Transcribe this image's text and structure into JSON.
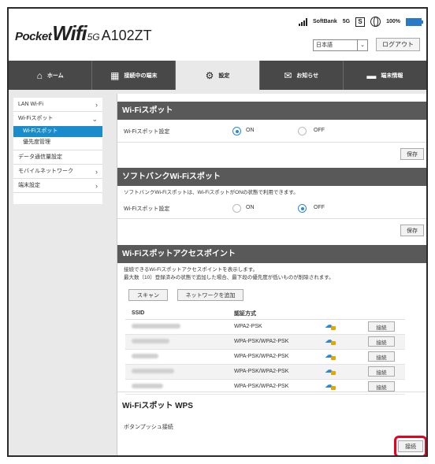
{
  "header": {
    "logo_pocket": "Pocket",
    "logo_wifi": "Wifi",
    "logo_5g": "5G",
    "model": "A102ZT",
    "carrier": "SoftBank",
    "network": "5G",
    "sim": "S",
    "battery": "100%",
    "language": "日本語",
    "logout_label": "ログアウト"
  },
  "nav": {
    "tabs": [
      {
        "label": "ホーム",
        "icon": "home-icon"
      },
      {
        "label": "接続中の端末",
        "icon": "devices-icon"
      },
      {
        "label": "設定",
        "icon": "gear-icon"
      },
      {
        "label": "お知らせ",
        "icon": "mail-icon"
      },
      {
        "label": "端末情報",
        "icon": "device-info-icon"
      }
    ],
    "active_tab": "設定"
  },
  "sidebar": {
    "items": [
      {
        "label": "LAN Wi-Fi"
      },
      {
        "label": "Wi-Fiスポット"
      },
      {
        "label": "データ通信量設定"
      },
      {
        "label": "モバイルネットワーク"
      },
      {
        "label": "端末設定"
      }
    ],
    "subitems": [
      {
        "label": "Wi-Fiスポット",
        "active": true
      },
      {
        "label": "優先度管理",
        "active": false
      }
    ]
  },
  "wifi_spot": {
    "title": "Wi-Fiスポット",
    "setting_label": "Wi-Fiスポット設定",
    "on_label": "ON",
    "off_label": "OFF",
    "selected": "ON",
    "save_label": "保存"
  },
  "softbank_spot": {
    "title": "ソフトバンクWi-Fiスポット",
    "description": "ソフトバンクWi-Fiスポットは、Wi-FiスポットがONの状態で利用できます。",
    "setting_label": "Wi-Fiスポット設定",
    "on_label": "ON",
    "off_label": "OFF",
    "selected": "OFF",
    "save_label": "保存"
  },
  "access_points": {
    "title": "Wi-Fiスポットアクセスポイント",
    "description_1": "接続できるWi-Fiスポットアクセスポイントを表示します。",
    "description_2": "最大数（10）登録済みの状態で追加した場合、最下段の優先度が低いものが削除されます。",
    "scan_label": "スキャン",
    "add_network_label": "ネットワークを追加",
    "col_ssid": "SSID",
    "col_auth": "認証方式",
    "connect_label": "接続",
    "rows": [
      {
        "auth": "WPA2-PSK"
      },
      {
        "auth": "WPA-PSK/WPA2-PSK"
      },
      {
        "auth": "WPA-PSK/WPA2-PSK"
      },
      {
        "auth": "WPA-PSK/WPA2-PSK"
      },
      {
        "auth": "WPA-PSK/WPA2-PSK"
      }
    ]
  },
  "wps": {
    "title": "Wi-Fiスポット WPS",
    "push_button_label": "ボタンプッシュ接続",
    "connect_label": "接続"
  },
  "colors": {
    "accent": "#1a8ccc",
    "nav_bg": "#484848",
    "section_header": "#595959",
    "highlight": "#e8001e"
  }
}
